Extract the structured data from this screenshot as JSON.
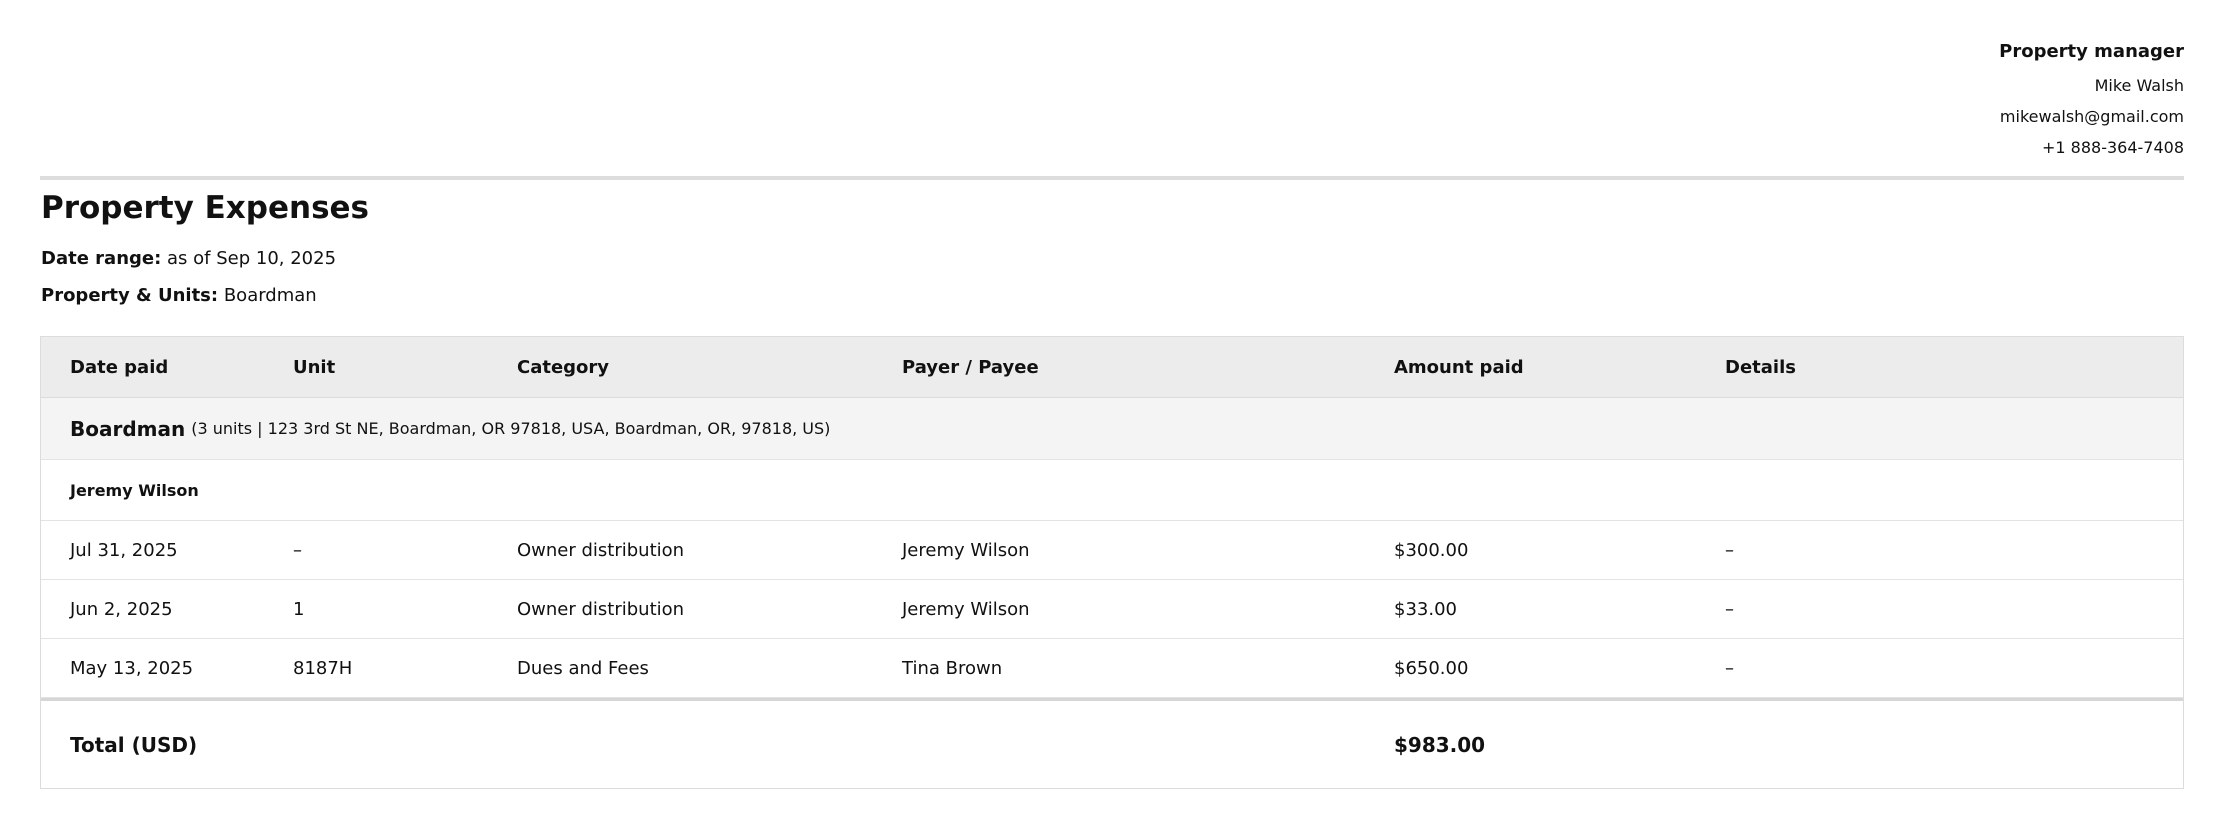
{
  "manager": {
    "heading": "Property manager",
    "name": "Mike Walsh",
    "email": "mikewalsh@gmail.com",
    "phone": "+1 888-364-7408"
  },
  "report": {
    "title": "Property Expenses",
    "date_range_label": "Date range:",
    "date_range_value": "as of Sep 10, 2025",
    "property_label": "Property & Units:",
    "property_value": "Boardman"
  },
  "table": {
    "columns": [
      "Date paid",
      "Unit",
      "Category",
      "Payer / Payee",
      "Amount paid",
      "Details"
    ],
    "group": {
      "name": "Boardman",
      "info": "(3 units | 123 3rd St NE, Boardman, OR 97818, USA, Boardman, OR, 97818, US)"
    },
    "owner": "Jeremy Wilson",
    "rows": [
      {
        "date": "Jul 31, 2025",
        "unit": "–",
        "category": "Owner distribution",
        "payee": "Jeremy Wilson",
        "amount": "$300.00",
        "details": "–"
      },
      {
        "date": "Jun 2, 2025",
        "unit": "1",
        "category": "Owner distribution",
        "payee": "Jeremy Wilson",
        "amount": "$33.00",
        "details": "–"
      },
      {
        "date": "May 13, 2025",
        "unit": "8187H",
        "category": "Dues and Fees",
        "payee": "Tina Brown",
        "amount": "$650.00",
        "details": "–"
      }
    ],
    "total_label": "Total (USD)",
    "total_amount": "$983.00"
  }
}
